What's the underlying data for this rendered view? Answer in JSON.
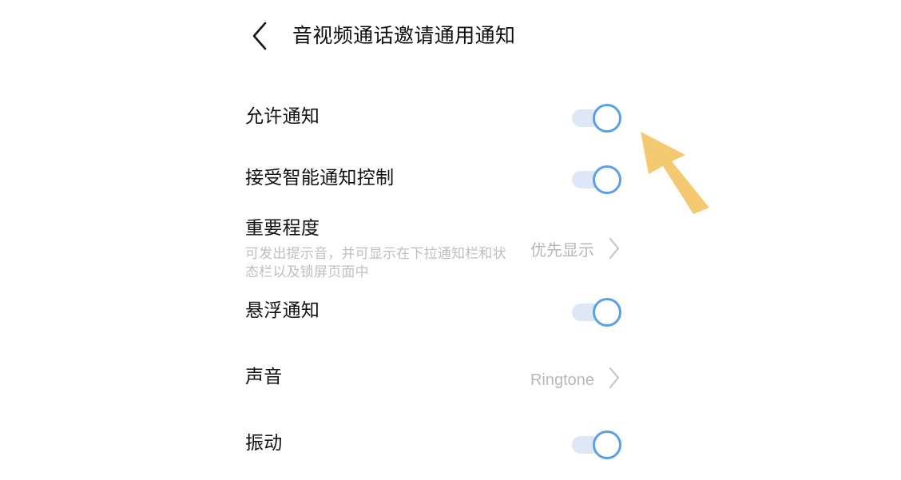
{
  "header": {
    "back_icon": "chevron-left-icon",
    "title": "音视频通话邀请通用通知"
  },
  "settings": {
    "rows": [
      {
        "id": "allow-notifications",
        "title": "允许通知",
        "subtitle": "",
        "control": "toggle",
        "toggle_on": true,
        "value": ""
      },
      {
        "id": "smart-notification-control",
        "title": "接受智能通知控制",
        "subtitle": "",
        "control": "toggle",
        "toggle_on": true,
        "value": ""
      },
      {
        "id": "importance",
        "title": "重要程度",
        "subtitle": "可发出提示音，并可显示在下拉通知栏和状态栏以及锁屏页面中",
        "control": "value-chevron",
        "toggle_on": false,
        "value": "优先显示",
        "chevron_icon": "chevron-right-icon"
      },
      {
        "id": "floating-notification",
        "title": "悬浮通知",
        "subtitle": "",
        "control": "toggle",
        "toggle_on": true,
        "value": ""
      },
      {
        "id": "sound",
        "title": "声音",
        "subtitle": "",
        "control": "value-chevron",
        "toggle_on": false,
        "value": "Ringtone",
        "chevron_icon": "chevron-right-icon"
      },
      {
        "id": "vibration",
        "title": "振动",
        "subtitle": "",
        "control": "toggle",
        "toggle_on": true,
        "value": ""
      }
    ]
  },
  "cursor": {
    "icon": "arrow-cursor-icon",
    "color": "#F3C971"
  },
  "colors": {
    "background": "#ffffff",
    "title_text": "#111111",
    "secondary_text": "#bfbfbf",
    "toggle_track": "#dde7f6",
    "toggle_ring": "#5aa0e8",
    "cursor": "#F3C971"
  }
}
